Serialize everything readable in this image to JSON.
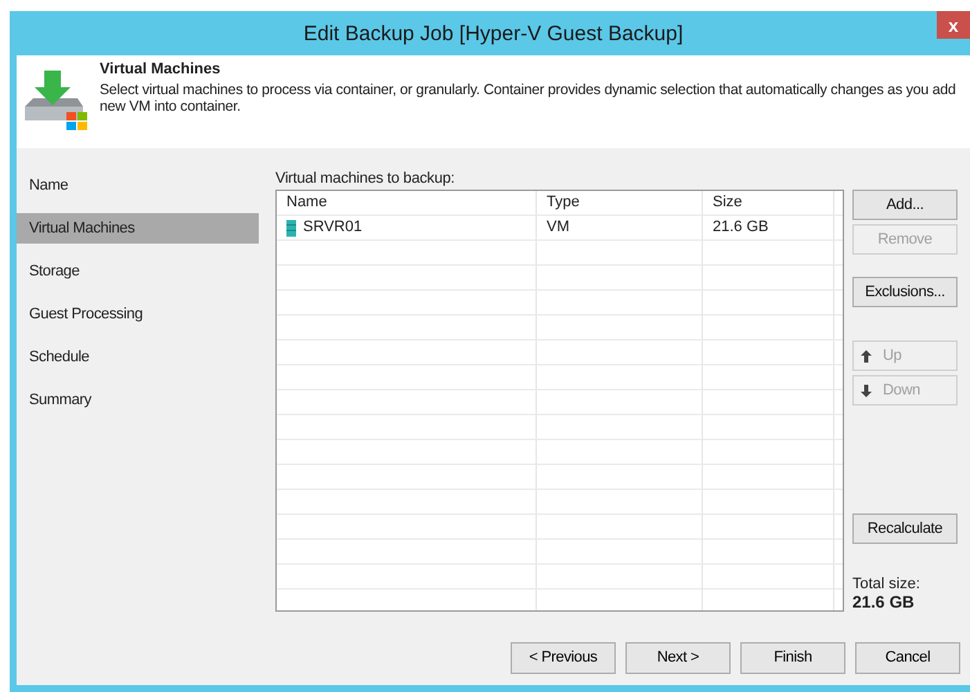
{
  "window": {
    "title": "Edit Backup Job [Hyper-V Guest Backup]",
    "close": "x"
  },
  "header": {
    "title": "Virtual Machines",
    "description": "Select virtual machines to process via container, or granularly. Container provides dynamic selection that automatically changes as you add new VM into container."
  },
  "sidebar": {
    "items": [
      {
        "label": "Name",
        "selected": false
      },
      {
        "label": "Virtual Machines",
        "selected": true
      },
      {
        "label": "Storage",
        "selected": false
      },
      {
        "label": "Guest Processing",
        "selected": false
      },
      {
        "label": "Schedule",
        "selected": false
      },
      {
        "label": "Summary",
        "selected": false
      }
    ]
  },
  "table": {
    "label": "Virtual machines to backup:",
    "columns": [
      "Name",
      "Type",
      "Size"
    ],
    "rows": [
      {
        "name": "SRVR01",
        "type": "VM",
        "size": "21.6 GB"
      }
    ]
  },
  "side_buttons": [
    {
      "label": "Add...",
      "disabled": false,
      "kind": "plain"
    },
    {
      "label": "Remove",
      "disabled": true,
      "kind": "plain"
    },
    {
      "label": "Exclusions...",
      "disabled": false,
      "kind": "plain"
    },
    {
      "label": "Up",
      "disabled": true,
      "kind": "up"
    },
    {
      "label": "Down",
      "disabled": true,
      "kind": "down"
    },
    {
      "label": "Recalculate",
      "disabled": false,
      "kind": "plain"
    }
  ],
  "total": {
    "label": "Total size:",
    "value": "21.6 GB"
  },
  "footer_buttons": [
    "< Previous",
    "Next >",
    "Finish",
    "Cancel"
  ]
}
